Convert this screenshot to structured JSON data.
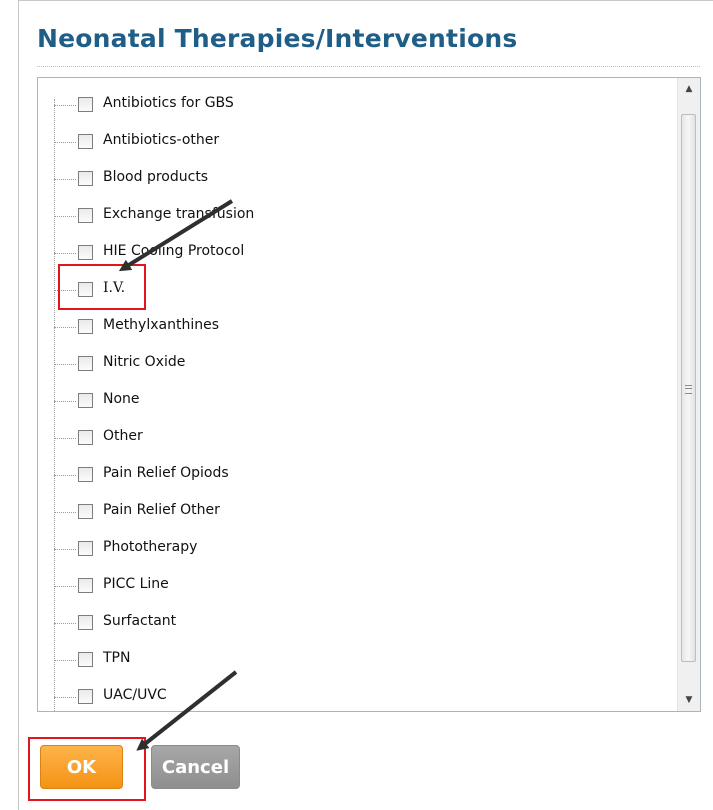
{
  "title": "Neonatal Therapies/Interventions",
  "items": [
    {
      "label": "Antibiotics for GBS"
    },
    {
      "label": "Antibiotics-other"
    },
    {
      "label": "Blood products"
    },
    {
      "label": "Exchange transfusion"
    },
    {
      "label": "HIE Cooling Protocol"
    },
    {
      "label": "I.V."
    },
    {
      "label": "Methylxanthines"
    },
    {
      "label": "Nitric Oxide"
    },
    {
      "label": "None"
    },
    {
      "label": "Other"
    },
    {
      "label": "Pain Relief Opiods"
    },
    {
      "label": "Pain Relief Other"
    },
    {
      "label": "Phototherapy"
    },
    {
      "label": "PICC Line"
    },
    {
      "label": "Surfactant"
    },
    {
      "label": "TPN"
    },
    {
      "label": "UAC/UVC"
    }
  ],
  "buttons": {
    "ok": "OK",
    "cancel": "Cancel"
  },
  "colors": {
    "title": "#1f5e87",
    "highlight": "#e0161c",
    "ok_button": "#f39314",
    "cancel_button": "#8f8f8f"
  }
}
